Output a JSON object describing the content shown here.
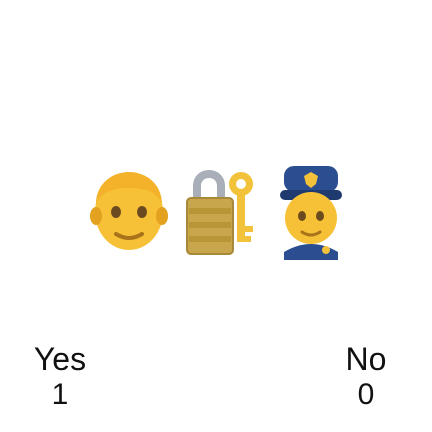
{
  "emojis": [
    {
      "icon": "man-face-icon"
    },
    {
      "icon": "locked-with-key-icon"
    },
    {
      "icon": "police-officer-icon"
    }
  ],
  "options": {
    "yes": {
      "label": "Yes",
      "value": "1"
    },
    "no": {
      "label": "No",
      "value": "0"
    }
  },
  "colors": {
    "skin": "#F7C137",
    "skin_shade": "#E2A11E",
    "hair": "#F4B22A",
    "lock_body": "#C8A64B",
    "lock_shackle": "#A9AFB8",
    "police_blue": "#2A4E8F",
    "badge_gold": "#F2C23A",
    "text": "#111111"
  }
}
